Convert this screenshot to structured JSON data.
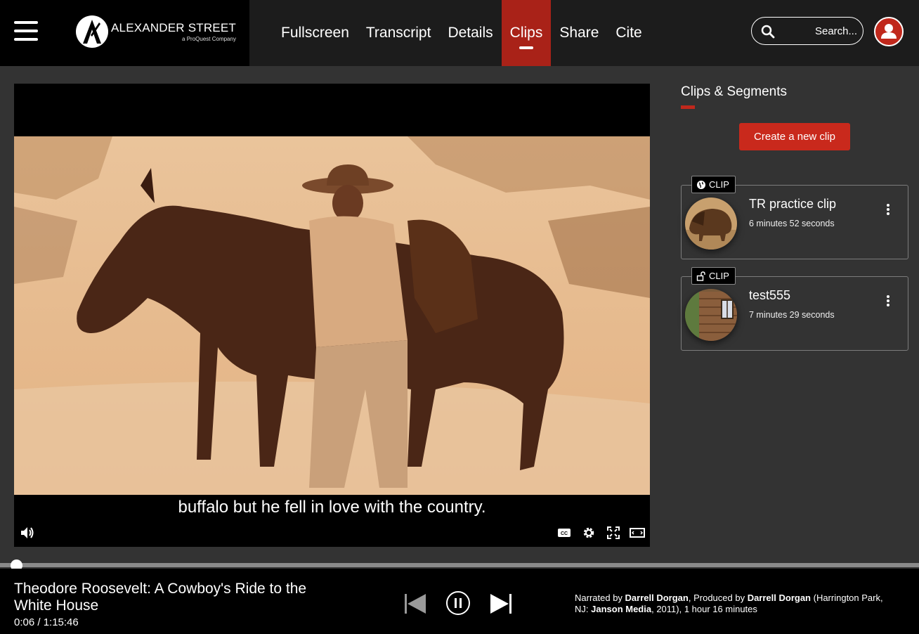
{
  "header": {
    "logo_name": "ALEXANDER STREET",
    "logo_sub": "a ProQuest Company",
    "nav": [
      "Fullscreen",
      "Transcript",
      "Details",
      "Clips",
      "Share",
      "Cite"
    ],
    "active_nav": "Clips",
    "search_placeholder": "Search..."
  },
  "player": {
    "caption": "buffalo but he fell in love with the country.",
    "controls": [
      "volume-icon",
      "closed-captions-icon",
      "settings-gear-icon",
      "expand-icon",
      "theater-mode-icon"
    ],
    "progress_fraction": 0.0013
  },
  "sidebar": {
    "title": "Clips & Segments",
    "create_label": "Create a new clip",
    "clips": [
      {
        "badge": "CLIP",
        "badge_icon": "globe-icon",
        "title": "TR practice clip",
        "duration": "6 minutes 52 seconds",
        "thumb": "buffalo"
      },
      {
        "badge": "CLIP",
        "badge_icon": "unlock-icon",
        "title": "test555",
        "duration": "7 minutes 29 seconds",
        "thumb": "cabin"
      }
    ]
  },
  "footer": {
    "title": "Theodore Roosevelt: A Cowboy's Ride to the White House",
    "time": "0:06 / 1:15:46",
    "credits": {
      "narrated_prefix": "Narrated by ",
      "narrator": "Darrell Dorgan",
      "produced_prefix": ", Produced by ",
      "producer": "Darrell Dorgan",
      "place": " (Harrington Park, NJ: ",
      "publisher": "Janson Media",
      "suffix": ", 2011), 1 hour 16 minutes"
    }
  },
  "colors": {
    "accent": "#c0281c",
    "active_tab": "#a92218",
    "page_bg": "#333333"
  }
}
